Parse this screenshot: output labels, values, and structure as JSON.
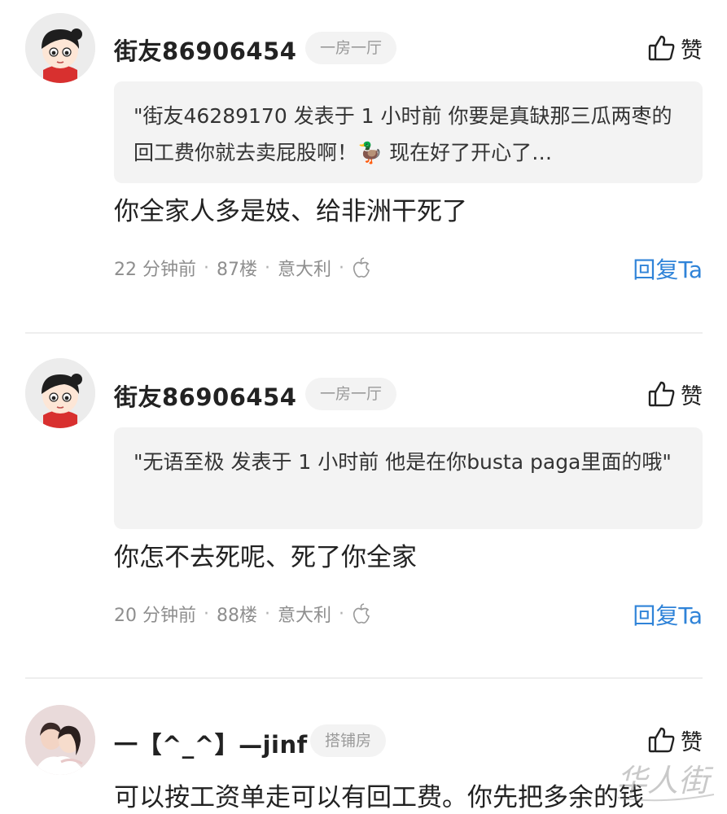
{
  "comments": [
    {
      "username": "街友86906454",
      "tag": "一房一厅",
      "like_label": "赞",
      "quote": "\"街友46289170 发表于 1 小时前 你要是真缺那三瓜两枣的回工费你就去卖屁股啊！🦆 现在好了开心了…",
      "text": "你全家人多是妓、给非洲干死了",
      "time": "22 分钟前",
      "floor": "87楼",
      "location": "意大利",
      "reply_label": "回复Ta"
    },
    {
      "username": "街友86906454",
      "tag": "一房一厅",
      "like_label": "赞",
      "quote": "\"无语至极 发表于 1 小时前 他是在你busta paga里面的哦\"",
      "text": "你怎不去死呢、死了你全家",
      "time": "20 分钟前",
      "floor": "88楼",
      "location": "意大利",
      "reply_label": "回复Ta"
    },
    {
      "username": "一【^_^】—jinf",
      "tag": "搭铺房",
      "like_label": "赞",
      "text": "可以按工资单走可以有回工费。你先把多余的钱"
    }
  ],
  "separator": "·",
  "watermark_text": "华人街",
  "colors": {
    "accent": "#2f83d8",
    "muted": "#8e8e8e",
    "quote_bg": "#f3f3f3"
  },
  "icons": {
    "like": "thumbs-up-icon",
    "device": "apple-icon",
    "avatar_default": "cartoon-girl-avatar"
  }
}
